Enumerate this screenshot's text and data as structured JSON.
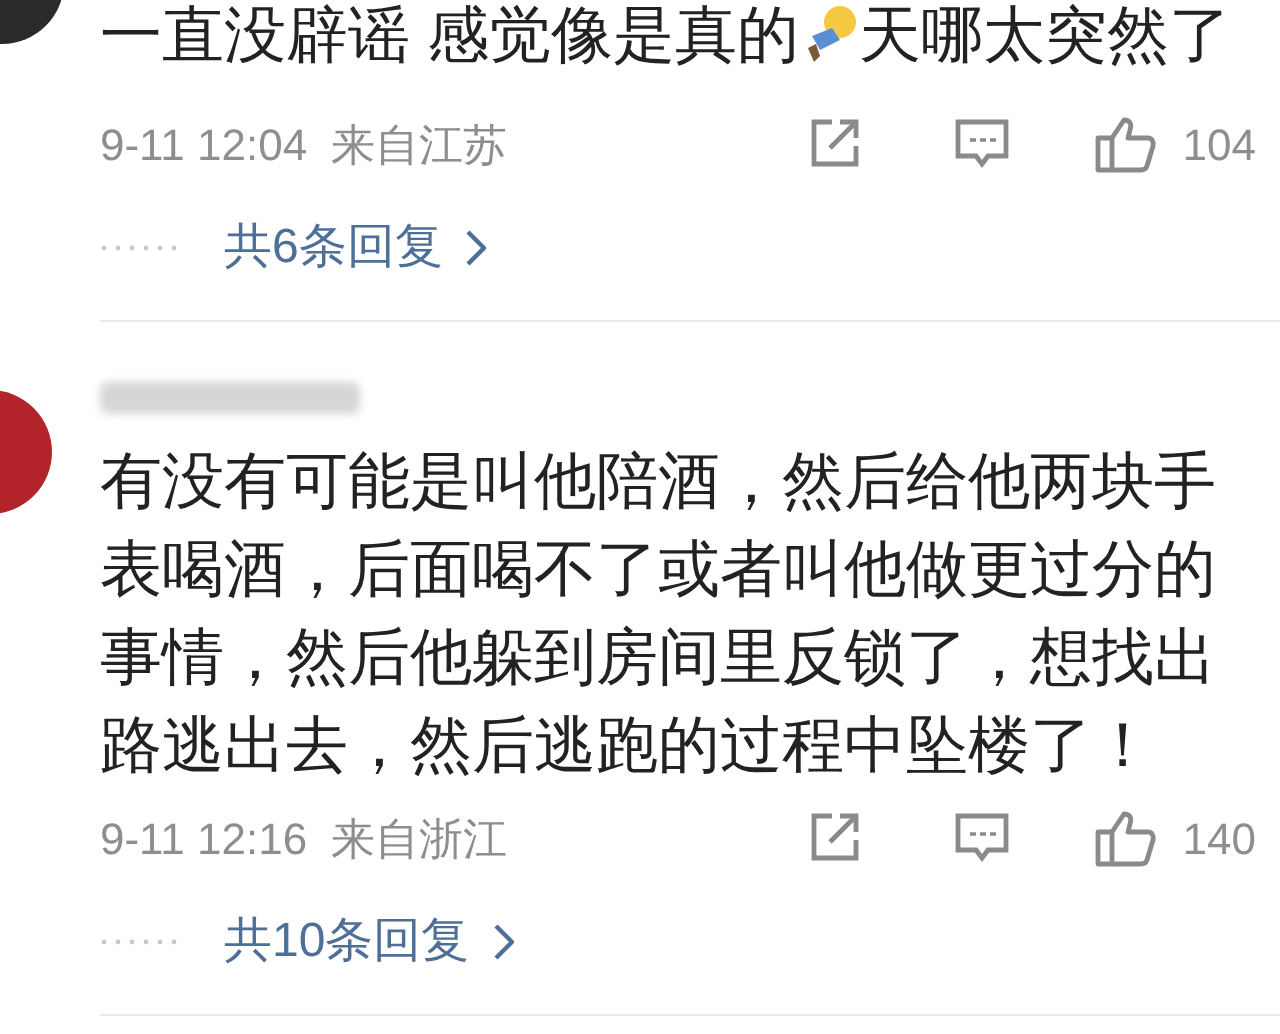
{
  "comments": [
    {
      "text_before": "一直没辟谣 感觉像是真的",
      "text_after": "天哪太突然了",
      "time": "9-11 12:04",
      "location": "来自江苏",
      "likes": "104",
      "replies": "共6条回复"
    },
    {
      "text": "有没有可能是叫他陪酒，然后给他两块手表喝酒，后面喝不了或者叫他做更过分的事情，然后他躲到房间里反锁了，想找出路逃出去，然后逃跑的过程中坠楼了！",
      "time": "9-11 12:16",
      "location": "来自浙江",
      "likes": "140",
      "replies": "共10条回复"
    }
  ]
}
